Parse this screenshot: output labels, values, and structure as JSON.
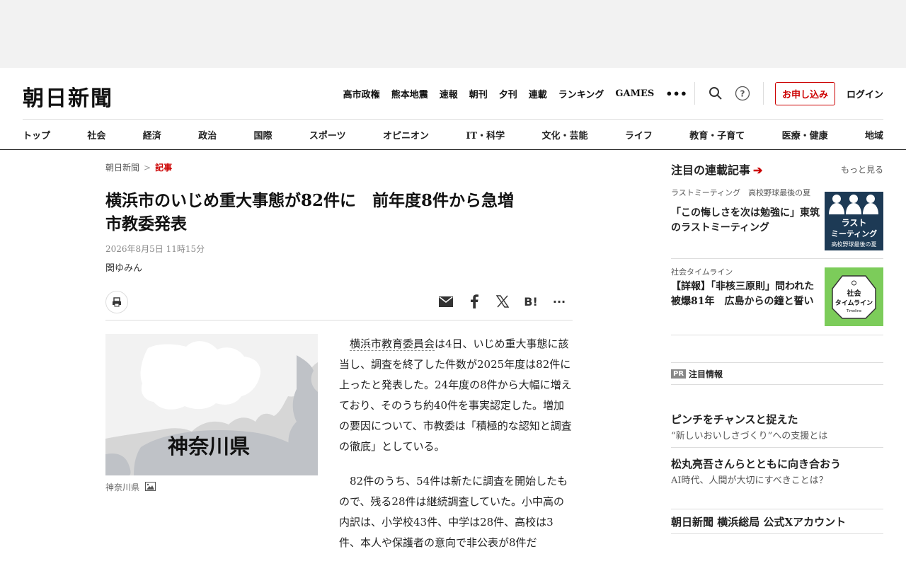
{
  "header": {
    "logo": "朝日新聞",
    "top_links": [
      "高市政権",
      "熊本地震",
      "速報",
      "朝刊",
      "夕刊",
      "連載",
      "ランキング",
      "GAMES"
    ],
    "subscribe": "お申し込み",
    "login": "ログイン"
  },
  "categories": [
    "トップ",
    "社会",
    "経済",
    "政治",
    "国際",
    "スポーツ",
    "オピニオン",
    "IT・科学",
    "文化・芸能",
    "ライフ",
    "教育・子育て",
    "医療・健康",
    "地域"
  ],
  "article": {
    "breadcrumb": [
      "朝日新聞",
      "記事"
    ],
    "title_line1": "横浜市のいじめ重大事態が82件に　前年度8件から急増",
    "title_line2": "市教委発表",
    "date": "2026年8月5日 11時15分",
    "author": "関ゆみん",
    "figure_label": "神奈川県",
    "figure_caption": "神奈川県",
    "para1_keyword": "横浜市教育委員会",
    "para1_rest": "は4日、いじめ重大事態に該当し、調査を終了した件数が2025年度は82件に上ったと発表した。24年度の8件から大幅に増えており、そのうち約40件を事実認定した。増加の要因について、市教委は「積極的な認知と調査の徹底」としている。",
    "para2": "82件のうち、54件は新たに調査を開始したもので、残る28件は継続調査していた。小中高の内訳は、小学校43件、中学は28件、高校は3件、本人や保護者の意向で非公表が8件だ"
  },
  "sidebar": {
    "title": "注目の連載記事",
    "more": "もっと見る",
    "series": [
      {
        "tag": "ラストミーティング　高校野球最後の夏",
        "text": "「この悔しさを次は勉強に」東筑のラストミーティング",
        "thumb_line1": "ラスト",
        "thumb_line2": "ミーティング",
        "thumb_line3": "高校野球最後の夏"
      },
      {
        "tag": "社会タイムライン",
        "text": "【詳報】「非核三原則」問われた被爆81年　広島からの鐘と誓い",
        "thumb_line1": "社会",
        "thumb_line2": "タイムライン",
        "thumb_line3": "Timeline"
      }
    ],
    "pr_badge": "PR",
    "pr_title": "注目情報",
    "promos": [
      {
        "title": "ピンチをチャンスと捉えた",
        "sub": "“新しいおいしさづくり”への支援とは"
      },
      {
        "title": "松丸亮吾さんらとともに向き合おう",
        "sub": "AI時代、人間が大切にすべきことは？"
      }
    ],
    "x_account": "朝日新聞 横浜総局 公式Xアカウント"
  },
  "colors": {
    "accent": "#cc0000",
    "thumb1": "#1d3a55",
    "thumb2": "#7ccc5a"
  }
}
